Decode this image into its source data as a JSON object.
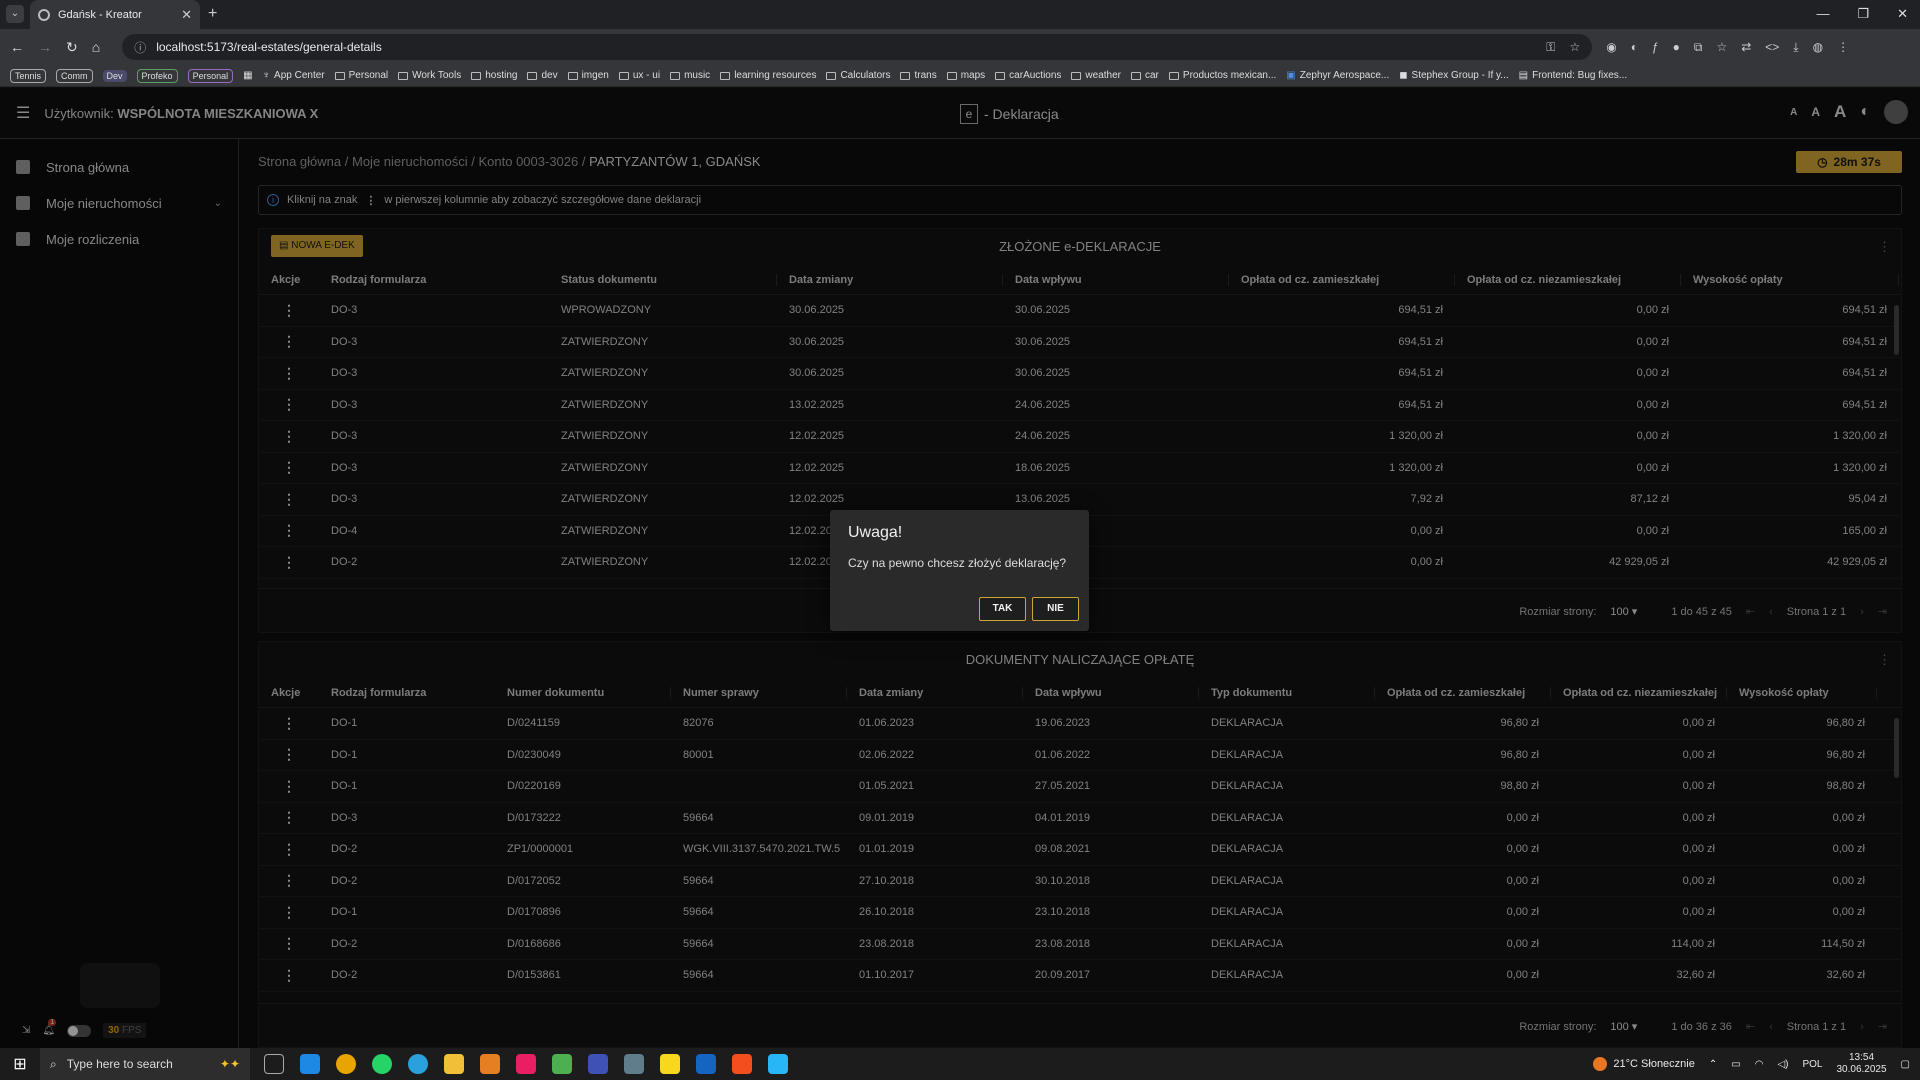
{
  "browser": {
    "tab_title": "Gdańsk - Kreator",
    "url": "localhost:5173/real-estates/general-details",
    "bookmarks_pills": [
      "Tennis",
      "Comm",
      "Dev",
      "Profeko",
      "Personal"
    ],
    "bookmarks": [
      "App Center",
      "Personal",
      "Work Tools",
      "hosting",
      "dev",
      "imgen",
      "ux - ui",
      "music",
      "learning resources",
      "Calculators",
      "trans",
      "maps",
      "carAuctions",
      "weather",
      "car",
      "Productos mexican...",
      "Zephyr Aerospace...",
      "Stephex Group - If y...",
      "Frontend: Bug fixes..."
    ]
  },
  "header": {
    "user_prefix": "Użytkownik:",
    "user_name": "WSPÓLNOTA MIESZKANIOWA X",
    "app_icon_letter": "e",
    "app_title": "- Deklaracja",
    "font_sizes": [
      "A",
      "A",
      "A"
    ]
  },
  "sidebar": {
    "items": [
      {
        "label": "Strona główna",
        "icon": "dashboard-icon"
      },
      {
        "label": "Moje nieruchomości",
        "icon": "buildings-icon"
      },
      {
        "label": "Moje rozliczenia",
        "icon": "bank-icon"
      }
    ],
    "notif_count": "1",
    "fps_value": "30",
    "fps_label": "FPS"
  },
  "breadcrumbs": [
    "Strona główna",
    "Moje nieruchomości",
    "Konto 0003-3026",
    "PARTYZANTÓW 1, GDAŃSK"
  ],
  "breadcrumb_sep": "/",
  "timer": "28m 37s",
  "info_bar": {
    "before": "Kliknij na znak",
    "after": "w pierwszej kolumnie aby zobaczyć szczegółowe dane deklaracji"
  },
  "declarations": {
    "title": "ZŁOŻONE e-DEKLARACJE",
    "new_button": "NOWA E-DEK",
    "columns": [
      "Akcje",
      "Rodzaj formularza",
      "Status dokumentu",
      "Data zmiany",
      "Data wpływu",
      "Opłata od cz. zamieszkałej",
      "Opłata od cz. niezamieszkałej",
      "Wysokość opłaty"
    ],
    "rows": [
      [
        "DO-3",
        "WPROWADZONY",
        "30.06.2025",
        "30.06.2025",
        "694,51 zł",
        "0,00 zł",
        "694,51 zł"
      ],
      [
        "DO-3",
        "ZATWIERDZONY",
        "30.06.2025",
        "30.06.2025",
        "694,51 zł",
        "0,00 zł",
        "694,51 zł"
      ],
      [
        "DO-3",
        "ZATWIERDZONY",
        "30.06.2025",
        "30.06.2025",
        "694,51 zł",
        "0,00 zł",
        "694,51 zł"
      ],
      [
        "DO-3",
        "ZATWIERDZONY",
        "13.02.2025",
        "24.06.2025",
        "694,51 zł",
        "0,00 zł",
        "694,51 zł"
      ],
      [
        "DO-3",
        "ZATWIERDZONY",
        "12.02.2025",
        "24.06.2025",
        "1 320,00 zł",
        "0,00 zł",
        "1 320,00 zł"
      ],
      [
        "DO-3",
        "ZATWIERDZONY",
        "12.02.2025",
        "18.06.2025",
        "1 320,00 zł",
        "0,00 zł",
        "1 320,00 zł"
      ],
      [
        "DO-3",
        "ZATWIERDZONY",
        "12.02.2025",
        "13.06.2025",
        "7,92 zł",
        "87,12 zł",
        "95,04 zł"
      ],
      [
        "DO-4",
        "ZATWIERDZONY",
        "12.02.2025",
        "",
        "0,00 zł",
        "0,00 zł",
        "165,00 zł"
      ],
      [
        "DO-2",
        "ZATWIERDZONY",
        "12.02.2025",
        "",
        "0,00 zł",
        "42 929,05 zł",
        "42 929,05 zł"
      ]
    ],
    "pager": {
      "size_label": "Rozmiar strony:",
      "size": "100",
      "range": "1 do 45 z 45",
      "page": "Strona 1 z 1"
    }
  },
  "documents": {
    "title": "DOKUMENTY NALICZAJĄCE OPŁATĘ",
    "columns": [
      "Akcje",
      "Rodzaj formularza",
      "Numer dokumentu",
      "Numer sprawy",
      "Data zmiany",
      "Data wpływu",
      "Typ dokumentu",
      "Opłata od cz. zamieszkałej",
      "Opłata od cz. niezamieszkałej",
      "Wysokość opłaty"
    ],
    "rows": [
      [
        "DO-1",
        "D/0241159",
        "82076",
        "01.06.2023",
        "19.06.2023",
        "DEKLARACJA",
        "96,80 zł",
        "0,00 zł",
        "96,80 zł"
      ],
      [
        "DO-1",
        "D/0230049",
        "80001",
        "02.06.2022",
        "01.06.2022",
        "DEKLARACJA",
        "96,80 zł",
        "0,00 zł",
        "96,80 zł"
      ],
      [
        "DO-1",
        "D/0220169",
        "",
        "01.05.2021",
        "27.05.2021",
        "DEKLARACJA",
        "98,80 zł",
        "0,00 zł",
        "98,80 zł"
      ],
      [
        "DO-3",
        "D/0173222",
        "59664",
        "09.01.2019",
        "04.01.2019",
        "DEKLARACJA",
        "0,00 zł",
        "0,00 zł",
        "0,00 zł"
      ],
      [
        "DO-2",
        "ZP1/0000001",
        "WGK.VIII.3137.5470.2021.TW.5",
        "01.01.2019",
        "09.08.2021",
        "DEKLARACJA",
        "0,00 zł",
        "0,00 zł",
        "0,00 zł"
      ],
      [
        "DO-2",
        "D/0172052",
        "59664",
        "27.10.2018",
        "30.10.2018",
        "DEKLARACJA",
        "0,00 zł",
        "0,00 zł",
        "0,00 zł"
      ],
      [
        "DO-1",
        "D/0170896",
        "59664",
        "26.10.2018",
        "23.10.2018",
        "DEKLARACJA",
        "0,00 zł",
        "0,00 zł",
        "0,00 zł"
      ],
      [
        "DO-2",
        "D/0168686",
        "59664",
        "23.08.2018",
        "23.08.2018",
        "DEKLARACJA",
        "0,00 zł",
        "114,00 zł",
        "114,50 zł"
      ],
      [
        "DO-2",
        "D/0153861",
        "59664",
        "01.10.2017",
        "20.09.2017",
        "DEKLARACJA",
        "0,00 zł",
        "32,60 zł",
        "32,60 zł"
      ]
    ],
    "pager": {
      "size_label": "Rozmiar strony:",
      "size": "100",
      "range": "1 do 36 z 36",
      "page": "Strona 1 z 1"
    }
  },
  "dialog": {
    "title": "Uwaga!",
    "message": "Czy na pewno chcesz złożyć deklarację?",
    "yes": "TAK",
    "no": "NIE"
  },
  "taskbar": {
    "search_placeholder": "Type here to search",
    "weather": "21°C Słonecznie",
    "lang": "POL",
    "time": "13:54",
    "date": "30.06.2025"
  },
  "colors": {
    "accent": "#cda436",
    "background": "#0d0d0d",
    "dialog_bg": "#2a2a2a"
  }
}
